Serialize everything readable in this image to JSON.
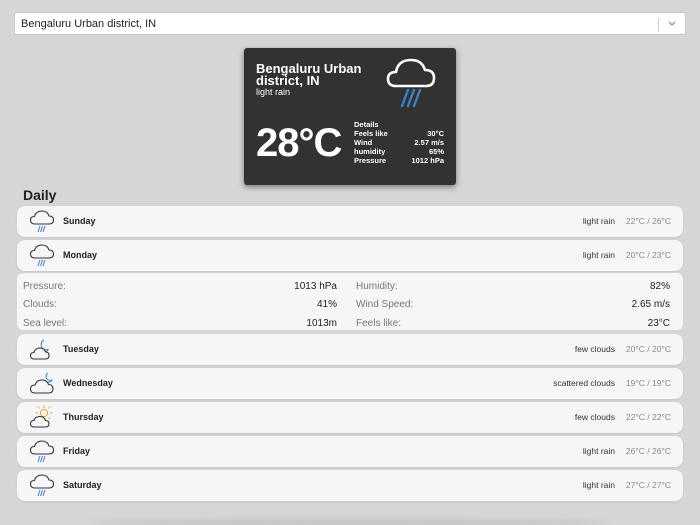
{
  "location_select": {
    "value": "Bengaluru Urban district, IN"
  },
  "current": {
    "city": "Bengaluru Urban district, IN",
    "description": "light rain",
    "temperature": "28°C",
    "icon": "rain-cloud-icon",
    "details_title": "Details",
    "details": [
      {
        "label": "Feels like",
        "value": "30°C"
      },
      {
        "label": "Wind",
        "value": "2.57 m/s"
      },
      {
        "label": "humidity",
        "value": "65%"
      },
      {
        "label": "Pressure",
        "value": "1012 hPa"
      }
    ]
  },
  "daily": {
    "title": "Daily",
    "days": [
      {
        "name": "Sunday",
        "description": "light rain",
        "temps": "22°C / 26°C",
        "icon": "rain-cloud-icon"
      },
      {
        "name": "Monday",
        "description": "light rain",
        "temps": "20°C / 23°C",
        "icon": "rain-cloud-icon"
      },
      {
        "name": "Tuesday",
        "description": "few clouds",
        "temps": "20°C / 20°C",
        "icon": "moon-cloud-icon"
      },
      {
        "name": "Wednesday",
        "description": "scattered clouds",
        "temps": "19°C / 19°C",
        "icon": "moon-cloud-icon"
      },
      {
        "name": "Thursday",
        "description": "few clouds",
        "temps": "22°C / 22°C",
        "icon": "sun-cloud-icon"
      },
      {
        "name": "Friday",
        "description": "light rain",
        "temps": "26°C / 26°C",
        "icon": "rain-cloud-icon"
      },
      {
        "name": "Saturday",
        "description": "light rain",
        "temps": "27°C / 27°C",
        "icon": "rain-cloud-icon"
      }
    ],
    "expanded": {
      "left": [
        {
          "label": "Pressure:",
          "value": "1013 hPa"
        },
        {
          "label": "Clouds:",
          "value": "41%"
        },
        {
          "label": "Sea level:",
          "value": "1013m"
        }
      ],
      "right": [
        {
          "label": "Humidity:",
          "value": "82%"
        },
        {
          "label": "Wind Speed:",
          "value": "2.65 m/s"
        },
        {
          "label": "Feels like:",
          "value": "23°C"
        }
      ]
    }
  },
  "colors": {
    "card_bg": "#333233",
    "rain_blue": "#3b82c4",
    "sun_orange": "#f0a02a",
    "page_bg": "#d6d5d8"
  }
}
